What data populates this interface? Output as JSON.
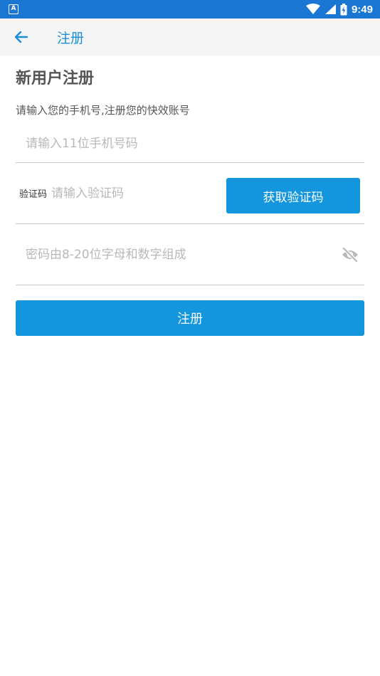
{
  "status_bar": {
    "notification_icon": "A",
    "time": "9:49"
  },
  "app_bar": {
    "back_icon": "arrow-left-icon",
    "title": "注册"
  },
  "form": {
    "heading": "新用户注册",
    "subtitle": "请输入您的手机号,注册您的快效账号",
    "phone_placeholder": "请输入11位手机号码",
    "code_label": "验证码",
    "code_placeholder": "请输入验证码",
    "get_code_label": "获取验证码",
    "password_placeholder": "密码由8-20位字母和数字组成",
    "password_toggle_icon": "eye-off-icon",
    "submit_label": "注册"
  },
  "colors": {
    "status_bar": "#1976d2",
    "accent": "#1396dd",
    "title_text": "#1a8fd8"
  }
}
